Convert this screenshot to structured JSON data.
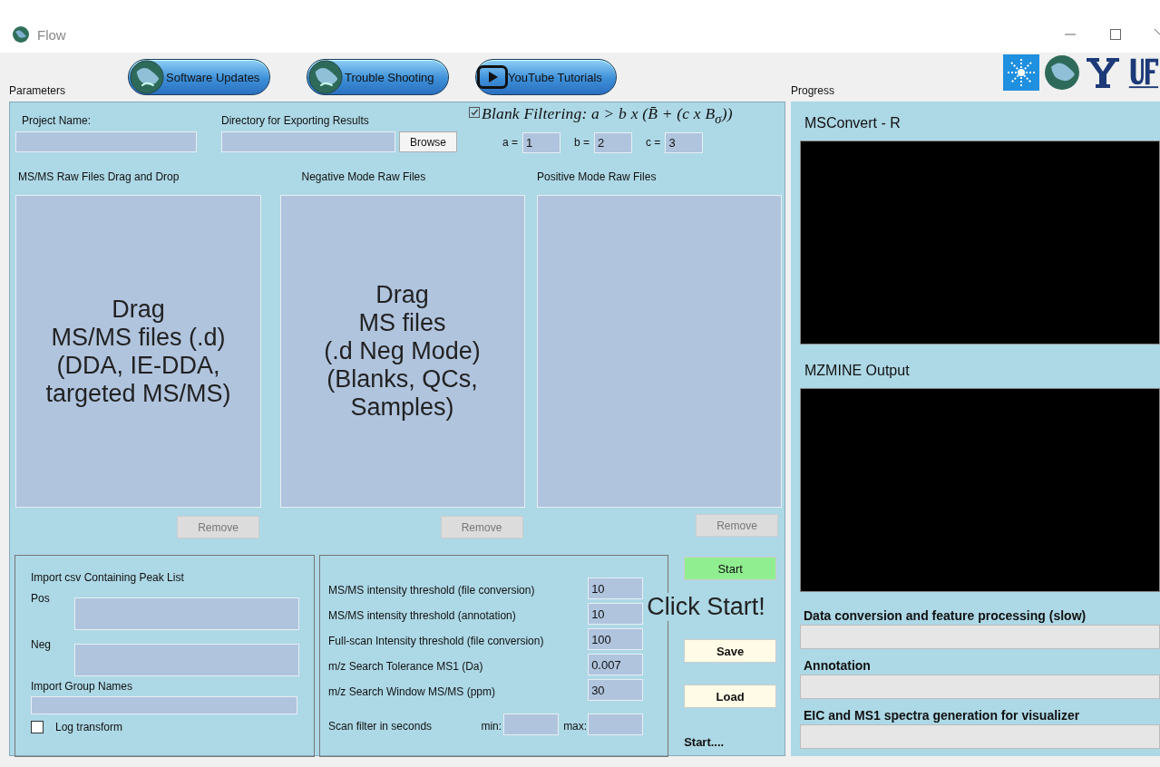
{
  "window": {
    "title": "Flow"
  },
  "toolbar_buttons": [
    {
      "label": "Software Updates",
      "kind": "globe"
    },
    {
      "label": "Trouble Shooting",
      "kind": "globe"
    },
    {
      "label": "YouTube Tutorials",
      "kind": "play"
    }
  ],
  "parameters": {
    "title": "Parameters",
    "project_name": {
      "label": "Project Name:"
    },
    "export_directory": {
      "label": "Directory for Exporting Results",
      "button": "Browse"
    },
    "blank_filter": {
      "checked": true,
      "formula": "Blank Filtering: a > b x (B̄ + (c x B$_{σ}$))",
      "fields": [
        {
          "label": "a =",
          "value": "1"
        },
        {
          "label": "b =",
          "value": "2"
        },
        {
          "label": "c =",
          "value": "3"
        }
      ]
    },
    "drop_zones": [
      {
        "title": "MS/MS Raw Files Drag and Drop",
        "hint": [
          "Drag",
          "MS/MS files (.d)",
          "(DDA, IE-DDA,",
          "targeted MS/MS)"
        ],
        "button": "Remove"
      },
      {
        "title": "Negative Mode Raw Files",
        "hint": [
          "Drag",
          "MS files",
          "(.d Neg Mode)",
          "(Blanks, QCs,",
          "Samples)"
        ],
        "button": "Remove"
      },
      {
        "title": "Positive Mode Raw Files",
        "button": "Remove"
      }
    ],
    "peak_list": {
      "title": "Import csv Containing Peak List",
      "fields": [
        {
          "label": "Pos"
        },
        {
          "label": "Neg"
        }
      ],
      "group_names": {
        "label": "Import Group Names"
      },
      "log_transform": {
        "label": "Log transform",
        "checked": false
      }
    },
    "thresholds": [
      {
        "label": "MS/MS intensity threshold (file conversion)",
        "value": "10"
      },
      {
        "label": "MS/MS intensity threshold (annotation)",
        "value": "10"
      },
      {
        "label": "Full-scan Intensity threshold (file conversion)",
        "value": "100"
      },
      {
        "label": "m/z Search Tolerance MS1 (Da)",
        "value": "0.007"
      },
      {
        "label": "m/z Search Window MS/MS (ppm)",
        "value": "30"
      }
    ],
    "scan_filter": {
      "label": "Scan filter in seconds",
      "min_label": "min:",
      "max_label": "max:"
    },
    "actions": {
      "start": "Start",
      "hint": "Click Start!",
      "save": "Save",
      "load": "Load",
      "status": "Start...."
    }
  },
  "progress": {
    "title": "Progress",
    "outputs": [
      {
        "title": "MSConvert - R"
      },
      {
        "title": "MZMINE Output"
      }
    ],
    "steps": [
      {
        "label": "Data conversion and feature processing (slow)",
        "level": 0
      },
      {
        "label": "Annotation",
        "level": 0
      },
      {
        "label": "EIC and MS1 spectra generation for visualizer",
        "level": 0
      }
    ]
  }
}
